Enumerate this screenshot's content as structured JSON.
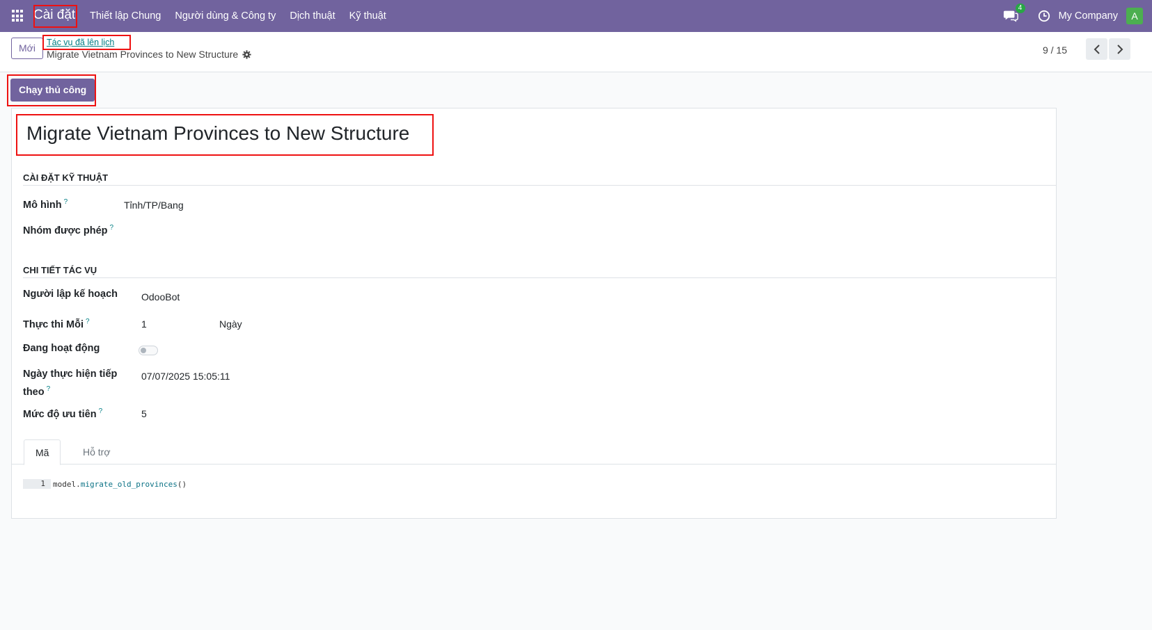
{
  "navbar": {
    "brand": "Cài đặt",
    "menu": [
      "Thiết lập Chung",
      "Người dùng & Công ty",
      "Dịch thuật",
      "Kỹ thuật"
    ],
    "chat_count": "4",
    "company": "My Company",
    "avatar_letter": "A"
  },
  "control": {
    "new_label": "Mới",
    "breadcrumb_parent": "Tác vụ đã lên lịch",
    "breadcrumb_current": "Migrate Vietnam Provinces to New Structure",
    "pager": "9 / 15"
  },
  "actions": {
    "run_label": "Chạy thủ công"
  },
  "form": {
    "title": "Migrate Vietnam Provinces to New Structure",
    "tech_section": "CÀI ĐẶT KỸ THUẬT",
    "model_label": "Mô hình",
    "model_value": "Tỉnh/TP/Bang",
    "groups_label": "Nhóm được phép",
    "task_section": "CHI TIẾT TÁC VỤ",
    "scheduler_label": "Người lập kế hoạch",
    "scheduler_value": "OdooBot",
    "interval_label": "Thực thi Mỗi",
    "interval_number": "1",
    "interval_unit": "Ngày",
    "active_label": "Đang hoạt động",
    "active": false,
    "nextcall_label": "Ngày thực hiện tiếp theo",
    "nextcall_value": "07/07/2025 15:05:11",
    "priority_label": "Mức độ ưu tiên",
    "priority_value": "5",
    "tabs": [
      "Mã",
      "Hỗ trợ"
    ],
    "code_line_number": "1",
    "code_object": "model.",
    "code_call": "migrate_old_provinces",
    "code_parens": "()"
  },
  "colors": {
    "brand_purple": "#71639e",
    "highlight_red": "#ee1111",
    "accent_teal": "#017e84"
  }
}
